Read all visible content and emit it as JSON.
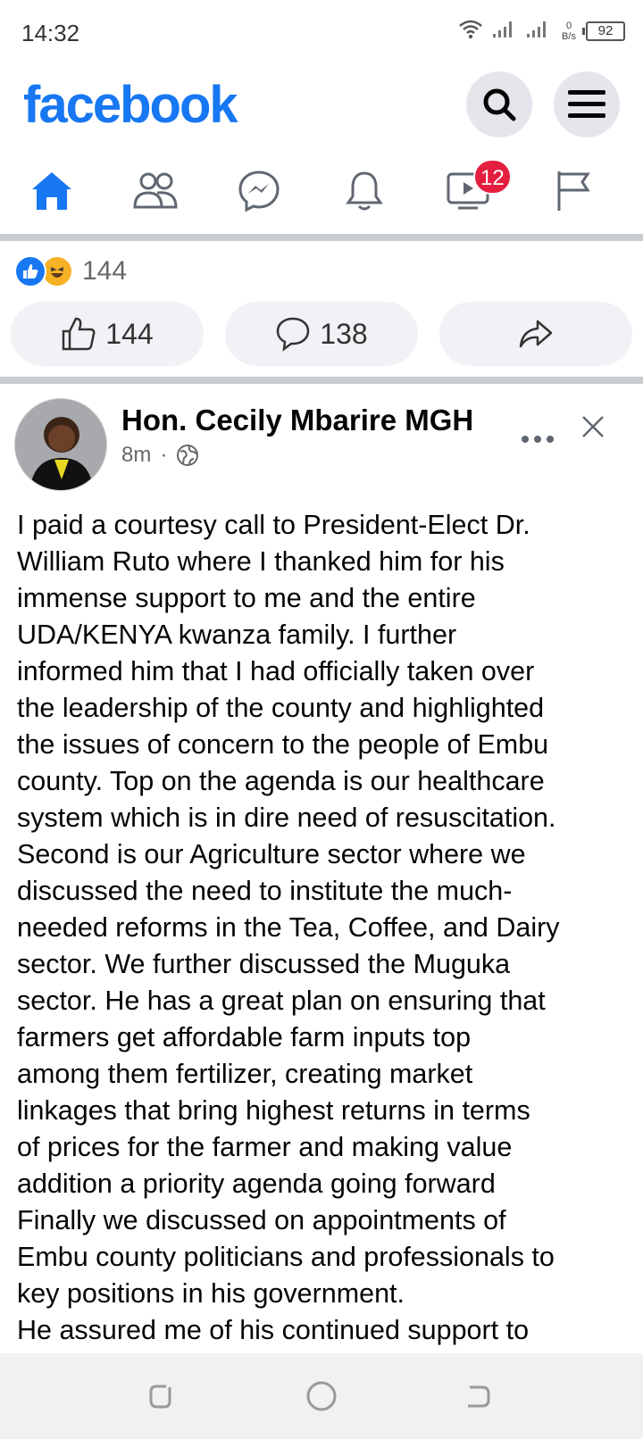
{
  "status": {
    "time": "14:32",
    "speed_value": "0",
    "speed_unit": "B/s",
    "battery": "92"
  },
  "header": {
    "logo": "facebook"
  },
  "nav": {
    "tabs": [
      {
        "name": "home",
        "icon": "home-icon"
      },
      {
        "name": "friends",
        "icon": "friends-icon"
      },
      {
        "name": "messenger",
        "icon": "messenger-icon"
      },
      {
        "name": "notifications",
        "icon": "bell-icon"
      },
      {
        "name": "watch",
        "icon": "video-icon",
        "badge": "12"
      },
      {
        "name": "pages",
        "icon": "flag-icon"
      }
    ]
  },
  "reactions": {
    "count": "144"
  },
  "actions": {
    "like_count": "144",
    "comment_count": "138"
  },
  "post": {
    "author": "Hon. Cecily Mbarire MGH",
    "time": "8m",
    "separator": "·",
    "text": "I paid a courtesy call to President-Elect Dr.\nWilliam Ruto where I thanked him for his\nimmense support to me and the entire\nUDA/KENYA kwanza family. I further\ninformed him that I had officially taken over\nthe leadership of the county and highlighted\nthe issues of concern to the people of Embu\ncounty. Top on the agenda is our healthcare\nsystem which is in dire need of resuscitation.\nSecond is our Agriculture sector where we\ndiscussed the need to institute the much-\nneeded reforms in the Tea, Coffee, and Dairy\nsector. We further discussed the Muguka\nsector. He has a great plan on ensuring that\nfarmers get affordable farm inputs top\namong them fertilizer, creating market\nlinkages that bring highest returns in terms\nof prices for the farmer and making value\naddition a priority agenda going forward\nFinally we discussed on appointments of\nEmbu county politicians and professionals to\nkey positions in his government.\nHe assured me of his continued support to"
  },
  "colors": {
    "brand": "#1877f2",
    "badge": "#e41e3f",
    "secondary_text": "#65676b"
  }
}
